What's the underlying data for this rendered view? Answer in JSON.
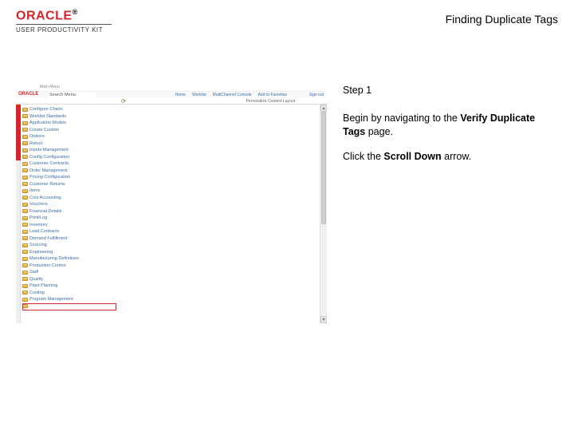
{
  "brand": {
    "name": "ORACLE",
    "sub": "USER PRODUCTIVITY KIT"
  },
  "title": "Finding Duplicate Tags",
  "instructions": {
    "step_label": "Step 1",
    "line1": "Begin by navigating to the ",
    "line1_bold": "Verify Duplicate Tags",
    "line1_suffix": " page.",
    "line2": "Click the ",
    "line2_bold": "Scroll Down",
    "line2_suffix": " arrow."
  },
  "shot": {
    "tab": "Main Menu",
    "search_label": "Search Menu:",
    "top_links": [
      "Home",
      "Worklist",
      "MultiChannel Console",
      "Add to Favorites"
    ],
    "signout": "Sign out",
    "subtext": "Personalize Content  Layout",
    "menu": [
      {
        "label": "Configure Charts",
        "caret": true
      },
      {
        "label": "Worklist Standards",
        "caret": false
      },
      {
        "label": "Application Models",
        "caret": false
      },
      {
        "label": "Create Custom",
        "caret": true
      },
      {
        "label": "Options",
        "caret": false
      },
      {
        "label": "Return",
        "caret": false
      },
      {
        "label": "Inputs Management",
        "caret": true
      },
      {
        "label": "Config Configuration",
        "caret": true
      },
      {
        "label": "Customer Contracts",
        "caret": true
      },
      {
        "label": "Order Management",
        "caret": true
      },
      {
        "label": "Pricing Configuration",
        "caret": true
      },
      {
        "label": "Customer Returns",
        "caret": false
      },
      {
        "label": "Items",
        "caret": false
      },
      {
        "label": "Cost Accounting",
        "caret": false
      },
      {
        "label": "Vouchers",
        "caret": false
      },
      {
        "label": "Financial Details",
        "caret": true
      },
      {
        "label": "Print/Log",
        "caret": false
      },
      {
        "label": "Inventory",
        "caret": true
      },
      {
        "label": "Load Contracts",
        "caret": true
      },
      {
        "label": "Demand Fulfillment",
        "caret": true
      },
      {
        "label": "Sourcing",
        "caret": false
      },
      {
        "label": "Engineering",
        "caret": true
      },
      {
        "label": "Manufacturing Definitions",
        "caret": true
      },
      {
        "label": "Production Control",
        "caret": true
      },
      {
        "label": "Staff",
        "caret": false
      },
      {
        "label": "Quality",
        "caret": false
      },
      {
        "label": "Plant Planning",
        "caret": false
      },
      {
        "label": "Costing",
        "caret": false
      },
      {
        "label": "Program Management",
        "caret": true
      },
      {
        "label": "",
        "caret": false
      }
    ]
  }
}
